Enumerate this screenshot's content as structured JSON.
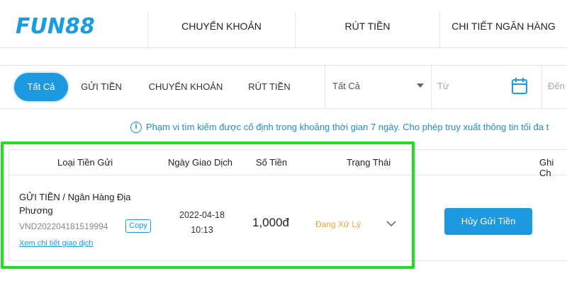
{
  "brand": {
    "logo_text": "FUN88",
    "logo_sub": ""
  },
  "top_nav": {
    "tabs": [
      {
        "label": "CHUYỂN KHOẢN"
      },
      {
        "label": "RÚT TIỀN"
      },
      {
        "label": "CHI TIẾT NGÂN HÀNG"
      }
    ]
  },
  "filters": {
    "pills": [
      {
        "label": "Tất Cả",
        "active": true
      },
      {
        "label": "GỬI TIỀN"
      },
      {
        "label": "CHUYỂN KHOẢN"
      },
      {
        "label": "RÚT TIỀN"
      }
    ],
    "select_value": "Tất Cả",
    "date_from_placeholder": "Từ",
    "date_to_placeholder": "Đến"
  },
  "info": {
    "text": "Phạm vi tìm kiếm được cố định trong khoảng thời gian 7 ngày. Cho phép truy xuất thông tin tối đa t"
  },
  "table": {
    "headers": [
      "Loại Tiền Gửi",
      "Ngày Giao Dịch",
      "Số Tiền",
      "Trạng Thái",
      "Ghi Ch"
    ],
    "rows": [
      {
        "type_line1": "GỬI TIỀN / Ngân Hàng Địa",
        "type_line2": "Phương",
        "reference": "VND202204181519994",
        "copy_label": "Copy",
        "detail_link": "Xem chi tiết giao dịch",
        "date": "2022-04-18",
        "time": "10:13",
        "amount": "1,000đ",
        "status": "Đang Xử Lý",
        "cancel_label": "Hủy Gửi Tiền"
      }
    ]
  },
  "colors": {
    "accent": "#1c99e0",
    "status_pending": "#e8a53a",
    "highlight": "#22dd22"
  },
  "icons": {
    "calendar": "calendar-icon",
    "info": "info-icon",
    "chevron": "chevron-down-icon",
    "select_arrow": "caret-down-icon"
  }
}
